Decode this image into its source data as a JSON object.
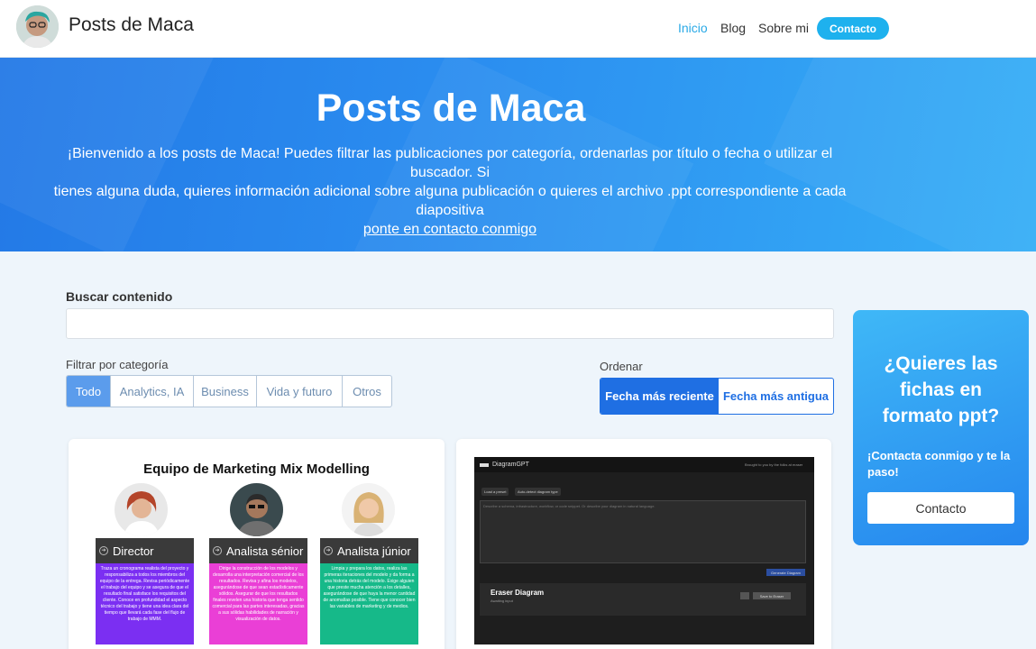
{
  "header": {
    "site_title": "Posts de Maca",
    "nav": [
      "Inicio",
      "Blog",
      "Sobre mi"
    ],
    "contact_button": "Contacto"
  },
  "hero": {
    "title": "Posts de Maca",
    "text_line1": "¡Bienvenido a los posts de Maca! Puedes filtrar las publicaciones por categoría, ordenarlas por título o fecha o utilizar el buscador. Si",
    "text_line2": "tienes alguna duda, quieres información adicional sobre alguna publicación o quieres el archivo .ppt correspondiente a cada diapositiva",
    "link": "ponte en contacto conmigo"
  },
  "search": {
    "label": "Buscar contenido",
    "value": "",
    "placeholder": ""
  },
  "filter": {
    "label": "Filtrar por categoría",
    "options": [
      "Todo",
      "Analytics, IA",
      "Business",
      "Vida y futuro",
      "Otros"
    ],
    "selected": "Todo"
  },
  "order": {
    "label": "Ordenar",
    "options": [
      "Fecha más reciente",
      "Fecha más antigua"
    ],
    "selected": "Fecha más reciente"
  },
  "side_card": {
    "title": "¿Quieres las fichas en formato ppt?",
    "subtitle": "¡Contacta conmigo y te la paso!",
    "button": "Contacto"
  },
  "cards": [
    {
      "title": "Equipo de Marketing Mix Modelling",
      "roles": [
        {
          "name": "Director",
          "color": "#7b2ff2",
          "text": "Traza un cronograma realista del proyecto y responsabiliza a todos los miembros del equipo de la entrega. Revisa periódicamente el trabajo del equipo y se asegura de que el resultado final satisface los requisitos del cliente. Conoce en profundidad el aspecto técnico del trabajo y tiene una idea clara del tiempo que llevará cada fase del flujo de trabajo de MMM."
        },
        {
          "name": "Analista sénior",
          "color": "#ea3fd6",
          "text": "Dirige la construcción de los modelos y desarrolla una interpretación comercial de los resultados. Revisa y afina los modelos, asegurándose de que sean estadísticamente sólidos. Asegurar de que los resultados finales revelen una historia que tenga sentido comercial para las partes interesadas, gracias a sus sólidas habilidades de narración y visualización de datos."
        },
        {
          "name": "Analista júnior",
          "color": "#16b989",
          "text": "Limpia y prepara los datos, realiza las primeras iteraciones del modelo y da forma a una historia detrás del modelo. Exige alguien que preste mucha atención a los detalles, asegurándose de que haya la menor cantidad de anomalías posible. Tiene que conocer bien las variables de marketing y de medios."
        }
      ]
    },
    {
      "app_title": "DiagramGPT",
      "top_right": "Brought to you by the folks at eraser",
      "pill1": "Load a preset",
      "pill2": "Auto-detect diagram type",
      "textarea_placeholder": "Describe a schema, infrastructure, workflow, or code snippet. Or describe your diagram in natural language.",
      "generate": "Generate Diagram",
      "panel_title": "Eraser Diagram",
      "panel_sub": "Awaiting input",
      "panel_btn": "Save to Eraser"
    }
  ],
  "colors": {
    "accent": "#1eb1ee",
    "order_active": "#1f6fe3",
    "filter_active": "#5b9cec"
  }
}
